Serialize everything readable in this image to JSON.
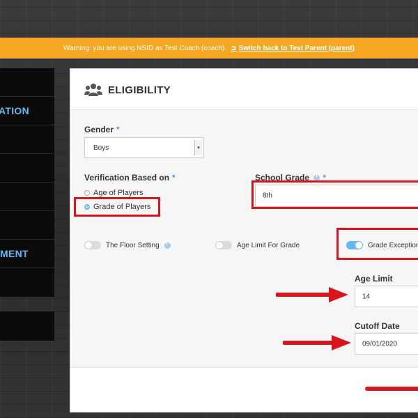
{
  "banner": {
    "warning_text": "Warning: you are using NSID as Test Coach (coach).",
    "switch_link": "Switch back to Test Parent (parent)"
  },
  "sidebar": {
    "items": [
      {
        "label": ""
      },
      {
        "label": "ATION"
      },
      {
        "label": ""
      },
      {
        "label": ""
      },
      {
        "label": ""
      },
      {
        "label": ""
      },
      {
        "label": "MENT"
      },
      {
        "label": ""
      }
    ]
  },
  "panel": {
    "title": "ELIGIBILITY",
    "icon": "users-group-icon"
  },
  "form": {
    "gender": {
      "label": "Gender",
      "value": "Boys"
    },
    "verification": {
      "label": "Verification Based on",
      "options": [
        "Age of Players",
        "Grade of Players"
      ],
      "selected": "Grade of Players"
    },
    "school_grade": {
      "label": "School Grade",
      "value": "8th"
    },
    "toggles": {
      "floor_setting": {
        "label": "The Floor Setting",
        "on": false
      },
      "age_limit_for_grade": {
        "label": "Age Limit For Grade",
        "on": false
      },
      "grade_exception": {
        "label": "Grade Exception",
        "on": true
      }
    },
    "age_limit": {
      "label": "Age Limit",
      "value": "14"
    },
    "cutoff_date": {
      "label": "Cutoff Date",
      "value": "09/01/2020"
    },
    "required_mark": "*"
  },
  "colors": {
    "accent": "#63b8f3",
    "warning": "#f5a623",
    "highlight": "#d7151b"
  }
}
